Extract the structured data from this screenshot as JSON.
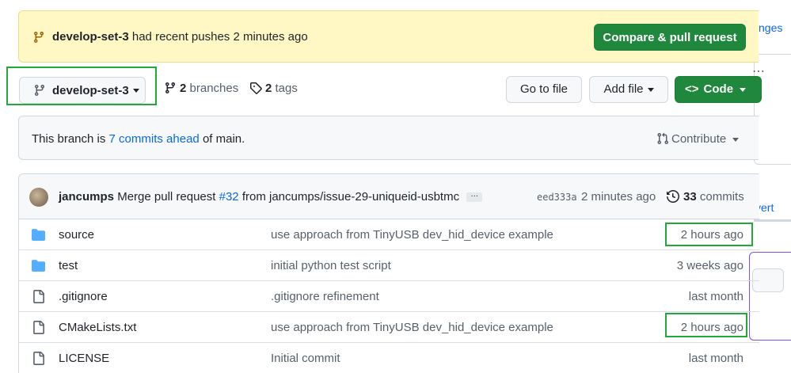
{
  "side": {
    "link_text": "nges",
    "revert_text": "vert"
  },
  "banner": {
    "branch": "develop-set-3",
    "message": "had recent pushes 2 minutes ago",
    "button": "Compare & pull request"
  },
  "toolbar": {
    "branch": "develop-set-3",
    "branches_count": "2",
    "branches_label": "branches",
    "tags_count": "2",
    "tags_label": "tags",
    "goto_file": "Go to file",
    "add_file": "Add file",
    "code": "Code"
  },
  "ahead": {
    "prefix": "This branch is",
    "link": "7 commits ahead",
    "suffix": "of main.",
    "contribute": "Contribute"
  },
  "latest_commit": {
    "author": "jancumps",
    "message_pre": "Merge pull request",
    "pr": "#32",
    "message_post": "from jancumps/issue-29-uniqueid-usbtmc",
    "ellipsis": "…",
    "sha": "eed333a",
    "time": "2 minutes ago",
    "commits_count": "33",
    "commits_label": "commits"
  },
  "files": [
    {
      "type": "folder",
      "name": "source",
      "message": "use approach from TinyUSB dev_hid_device example",
      "age": "2 hours ago"
    },
    {
      "type": "folder",
      "name": "test",
      "message": "initial python test script",
      "age": "3 weeks ago"
    },
    {
      "type": "file",
      "name": ".gitignore",
      "message": ".gitignore refinement",
      "age": "last month"
    },
    {
      "type": "file",
      "name": "CMakeLists.txt",
      "message": "use approach from TinyUSB dev_hid_device example",
      "age": "2 hours ago"
    },
    {
      "type": "file",
      "name": "LICENSE",
      "message": "Initial commit",
      "age": "last month"
    }
  ],
  "colors": {
    "primary_green": "#1f883d",
    "link_blue": "#0969da",
    "highlight_green": "#22a93a",
    "banner_yellow": "#fff8c5",
    "folder_blue": "#54aeff"
  }
}
